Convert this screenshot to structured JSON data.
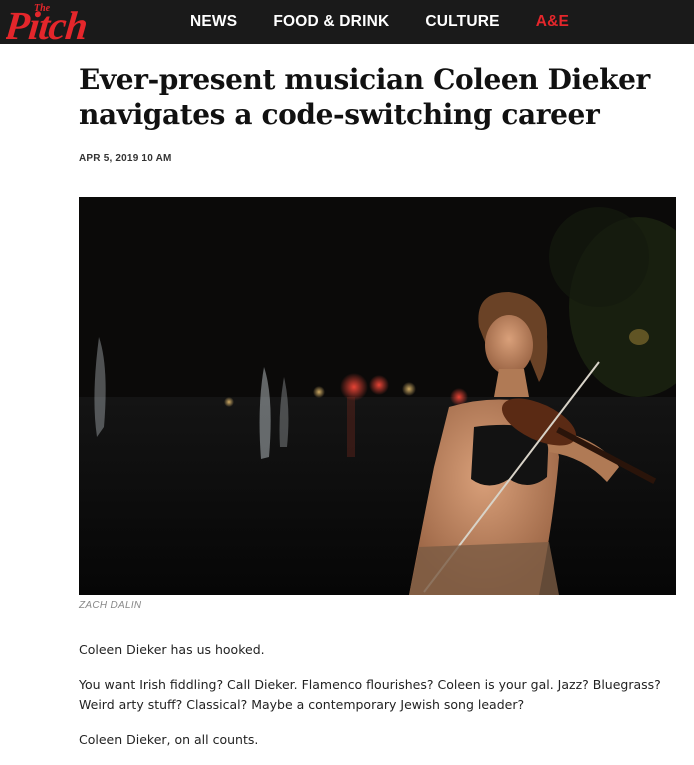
{
  "brand": {
    "logo_text": "Pitch",
    "logo_small_text": "The",
    "accent_color": "#e4262b",
    "nav_background": "#1a1a1a"
  },
  "nav": {
    "items": [
      {
        "label": "NEWS"
      },
      {
        "label": "FOOD & DRINK"
      },
      {
        "label": "CULTURE"
      },
      {
        "label": "A&E",
        "active": true
      }
    ]
  },
  "article": {
    "headline": "Ever-present musician Coleen Dieker navigates a code-switching career",
    "date": "APR 5, 2019 10 AM",
    "photo_credit": "ZACH DALIN",
    "paragraphs": [
      "Coleen Dieker has us hooked.",
      "You want Irish fiddling? Call Dieker. Flamenco flourishes? Coleen is your gal. Jazz? Bluegrass? Weird arty stuff? Classical? Maybe a contemporary Jewish song leader?",
      "Coleen Dieker, on all counts."
    ]
  }
}
